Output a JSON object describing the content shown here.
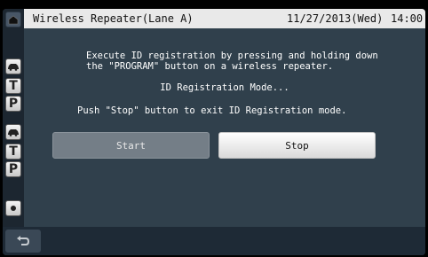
{
  "header": {
    "title": "Wireless Repeater(Lane A)",
    "date": "11/27/2013(Wed)",
    "time": "14:00"
  },
  "content": {
    "instruction_line1": "Execute ID registration by pressing and holding down",
    "instruction_line2": "the \"PROGRAM\" button on a wireless repeater.",
    "mode_status": "ID Registration Mode...",
    "exit_hint": "Push \"Stop\" button to exit ID Registration mode."
  },
  "buttons": {
    "start_label": "Start",
    "stop_label": "Stop"
  },
  "sidebar": {
    "items": [
      {
        "icon": "home-icon",
        "label": ""
      },
      {
        "icon": "car-icon",
        "label": ""
      },
      {
        "icon": "letter-t-icon",
        "label": "T"
      },
      {
        "icon": "letter-p-icon",
        "label": "P"
      },
      {
        "icon": "car-icon",
        "label": ""
      },
      {
        "icon": "letter-t-icon",
        "label": "T"
      },
      {
        "icon": "letter-p-icon",
        "label": "P"
      },
      {
        "icon": "dot-icon",
        "label": ""
      }
    ]
  },
  "footer": {
    "back_icon": "back-arrow-icon"
  },
  "colors": {
    "screen_bg": "#30404c",
    "header_bg": "#e9e9e9",
    "sidebar_bg": "#1c2630",
    "footer_bg": "#1e2a36",
    "start_button_bg": "#747e87",
    "stop_button_bg": "#ffffff"
  }
}
